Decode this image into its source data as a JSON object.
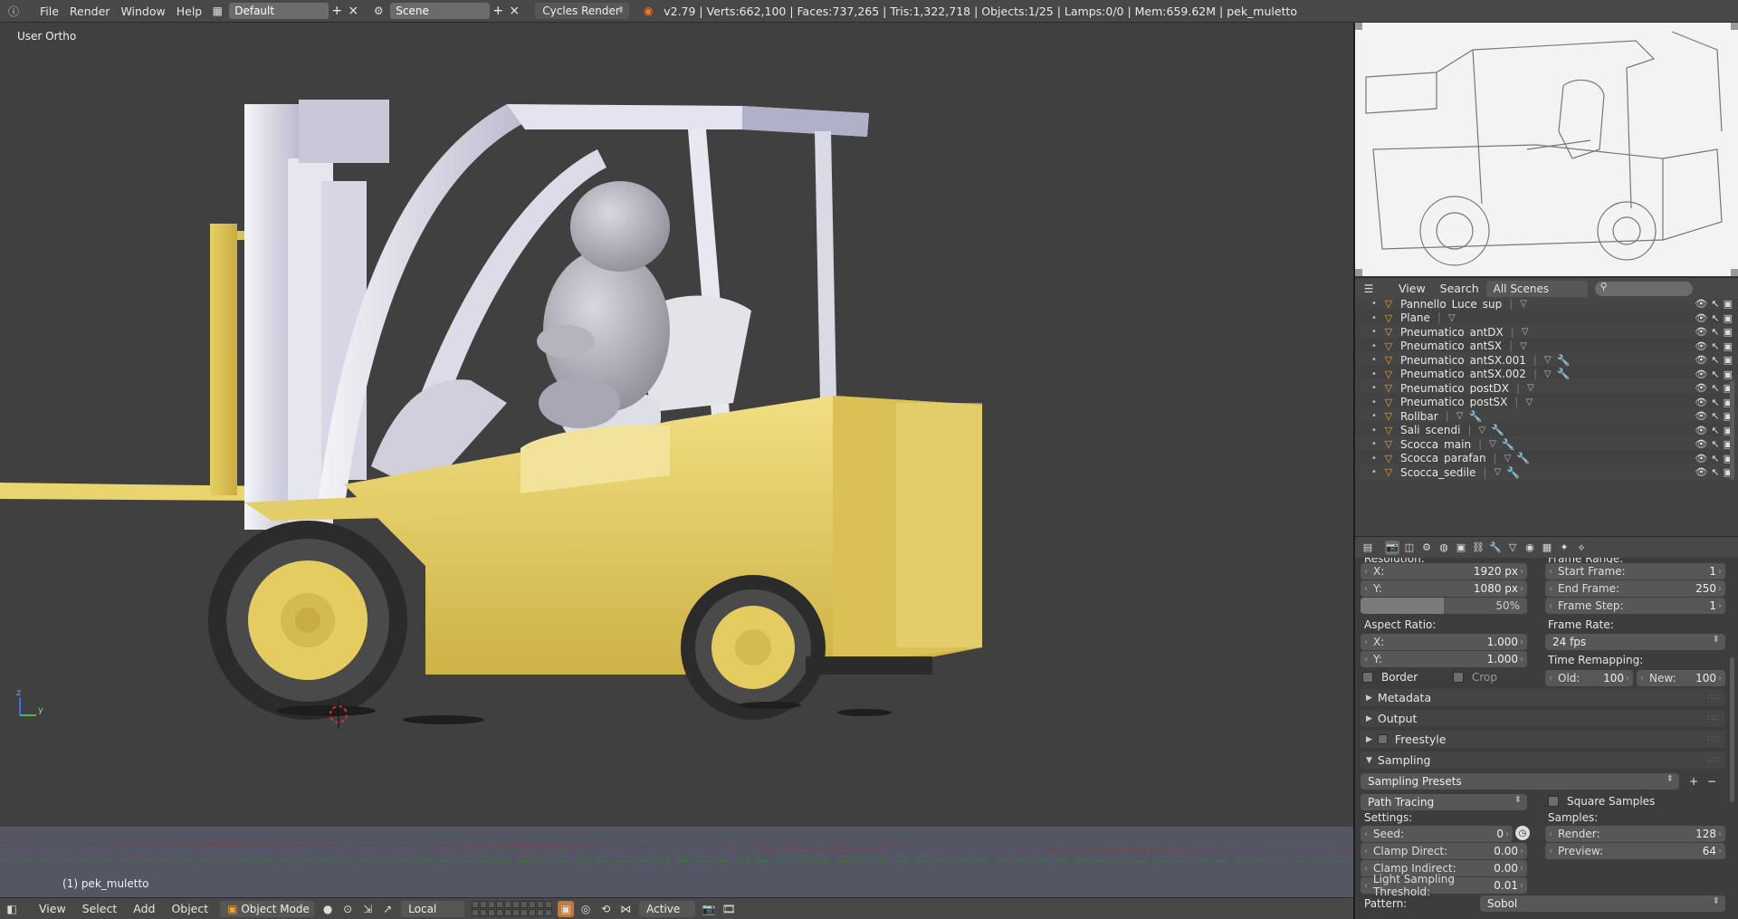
{
  "topbar": {
    "menus": [
      "File",
      "Render",
      "Window",
      "Help"
    ],
    "screen_layout": "Default",
    "scene": "Scene",
    "render_engine": "Cycles Render",
    "stats": "v2.79 | Verts:662,100 | Faces:737,265 | Tris:1,322,718 | Objects:1/25 | Lamps:0/0 | Mem:659.62M | pek_muletto"
  },
  "viewport": {
    "view_label": "User Ortho",
    "object_label": "(1) pek_muletto",
    "axis_z": "z",
    "axis_y": "y"
  },
  "viewport_header": {
    "menus": [
      "View",
      "Select",
      "Add",
      "Object"
    ],
    "mode": "Object Mode",
    "transform_orientation": "Local",
    "pivot_snap": "Active"
  },
  "outliner": {
    "menus": [
      "View",
      "Search"
    ],
    "display_mode": "All Scenes",
    "search_placeholder": "",
    "items": [
      {
        "name": "Pannello_Luce_sup",
        "modifier": false
      },
      {
        "name": "Plane",
        "modifier": false
      },
      {
        "name": "Pneumatico_antDX",
        "modifier": false
      },
      {
        "name": "Pneumatico_antSX",
        "modifier": false
      },
      {
        "name": "Pneumatico_antSX.001",
        "modifier": true
      },
      {
        "name": "Pneumatico_antSX.002",
        "modifier": true
      },
      {
        "name": "Pneumatico_postDX",
        "modifier": false
      },
      {
        "name": "Pneumatico_postSX",
        "modifier": false
      },
      {
        "name": "Rollbar",
        "modifier": true
      },
      {
        "name": "Sali_scendi",
        "modifier": true
      },
      {
        "name": "Scocca_main",
        "modifier": true
      },
      {
        "name": "Scocca_parafan",
        "modifier": true
      },
      {
        "name": "Scocca_sedile",
        "modifier": true
      }
    ]
  },
  "properties": {
    "resolution_label": "Resolution:",
    "res_x_key": "X:",
    "res_x": "1920 px",
    "res_y_key": "Y:",
    "res_y": "1080 px",
    "res_percent": "50%",
    "res_percent_value": 0.5,
    "frame_range_label": "Frame Range:",
    "start_frame_key": "Start Frame:",
    "start_frame": "1",
    "end_frame_key": "End Frame:",
    "end_frame": "250",
    "frame_step_key": "Frame Step:",
    "frame_step": "1",
    "aspect_label": "Aspect Ratio:",
    "aspect_x_key": "X:",
    "aspect_x": "1.000",
    "aspect_y_key": "Y:",
    "aspect_y": "1.000",
    "frame_rate_label": "Frame Rate:",
    "frame_rate": "24 fps",
    "time_remap_label": "Time Remapping:",
    "old_key": "Old:",
    "old": "100",
    "new_key": "New:",
    "new": "100",
    "border": "Border",
    "crop": "Crop",
    "panels": {
      "metadata": "Metadata",
      "output": "Output",
      "freestyle": "Freestyle",
      "sampling": "Sampling"
    },
    "sampling_presets": "Sampling Presets",
    "integrator": "Path Tracing",
    "square_samples": "Square Samples",
    "settings_label": "Settings:",
    "samples_label": "Samples:",
    "seed_key": "Seed:",
    "seed": "0",
    "clamp_direct_key": "Clamp Direct:",
    "clamp_direct": "0.00",
    "clamp_indirect_key": "Clamp Indirect:",
    "clamp_indirect": "0.00",
    "light_threshold_key": "Light Sampling Threshold:",
    "light_threshold": "0.01",
    "render_key": "Render:",
    "render": "128",
    "preview_key": "Preview:",
    "preview": "64",
    "pattern_key": "Pattern:",
    "pattern": "Sobol"
  },
  "colors": {
    "forklift_yellow": "#e8d06a",
    "cab_white": "#e8e8f0",
    "viewport_bg": "#404040",
    "object_type_icon": "#f0a030",
    "modifier_icon": "#6aa2ff"
  }
}
